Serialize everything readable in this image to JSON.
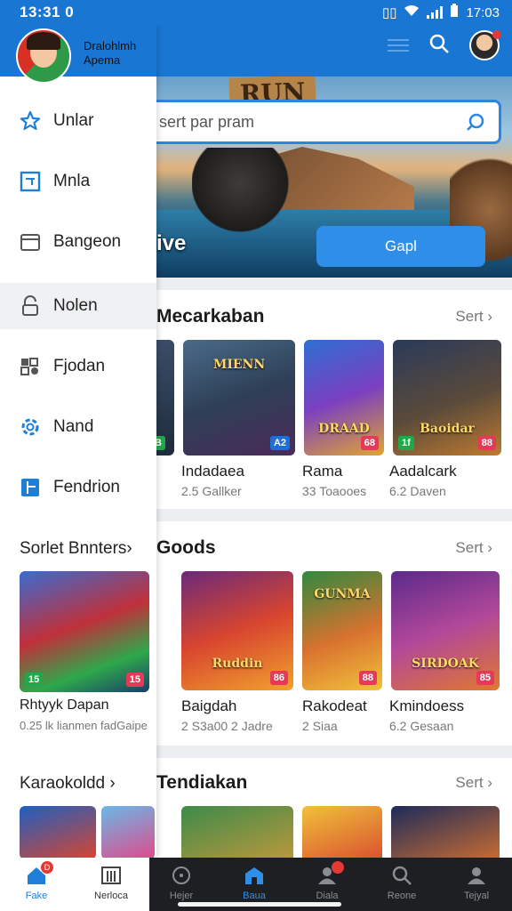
{
  "status_bar": {
    "time": "13:31 0",
    "right_time": "17:03"
  },
  "search": {
    "placeholder": "sert par pram"
  },
  "hero": {
    "banner": "RUN",
    "overlay_text": "ive",
    "cta_label": "Gapl"
  },
  "drawer": {
    "profile_name_line1": "Dralohlmh",
    "profile_name_line2": "Apema",
    "nav_items": [
      {
        "label": "Unlar",
        "icon": "star-icon"
      },
      {
        "label": "Mnla",
        "icon": "square-icon"
      },
      {
        "label": "Bangeon",
        "icon": "folder-icon"
      },
      {
        "label": "Nolen",
        "icon": "lock-icon",
        "active": true
      },
      {
        "label": "Fjodan",
        "icon": "game-pad-icon"
      },
      {
        "label": "Nand",
        "icon": "gear-icon"
      },
      {
        "label": "Fendrion",
        "icon": "book-icon"
      }
    ],
    "section1_title": "Sorlet Bnnters",
    "section1_games": [
      {
        "name": "Rhtyyk Dapan",
        "meta": "0.25 lk lianmen fadGaipe",
        "rating": "15",
        "rating2": "15"
      }
    ],
    "section2_title": "Karaokoldd"
  },
  "sections": [
    {
      "title": "Mecarkaban",
      "see_all": "Sert",
      "games": [
        {
          "name": "Indadaea",
          "meta": "2.5 Gallker",
          "tile_text": "MIENN",
          "rating": "A2"
        },
        {
          "name": "Rama",
          "meta": "33 Toaooes",
          "tile_text": "DRAAD",
          "rating": "68"
        },
        {
          "name": "Aadalcark",
          "meta": "6.2 Daven",
          "tile_text": "Baoidar",
          "rating": "88"
        }
      ]
    },
    {
      "title": "Goods",
      "see_all": "Sert",
      "games": [
        {
          "name": "Baigdah",
          "meta": "2 S3a00 2 Jadre",
          "tile_text": "Ruddin",
          "rating": "86"
        },
        {
          "name": "Rakodeat",
          "meta": "2 Siaa",
          "tile_text": "GUNMA",
          "rating": "88"
        },
        {
          "name": "Kmindoess",
          "meta": "6.2 Gesaan",
          "tile_text": "SIRDOAK",
          "rating": "85"
        }
      ]
    },
    {
      "title": "Tendiakan",
      "see_all": "Sert"
    }
  ],
  "bottom_nav": [
    {
      "label": "Fake",
      "icon": "home-icon",
      "badge": "D",
      "light": true,
      "selected": true
    },
    {
      "label": "Nerloca",
      "icon": "library-icon",
      "light": true
    },
    {
      "label": "Hejer",
      "icon": "disc-icon"
    },
    {
      "label": "Baua",
      "icon": "store-icon",
      "selected": true
    },
    {
      "label": "Diala",
      "icon": "person-icon",
      "dot": true
    },
    {
      "label": "Reone",
      "icon": "search-icon"
    },
    {
      "label": "Tejyal",
      "icon": "profile-icon"
    }
  ],
  "colors": {
    "primary": "#1976d2",
    "accent": "#2f8fe8",
    "rating_red": "#e53958",
    "rating_green": "#22a84b"
  }
}
